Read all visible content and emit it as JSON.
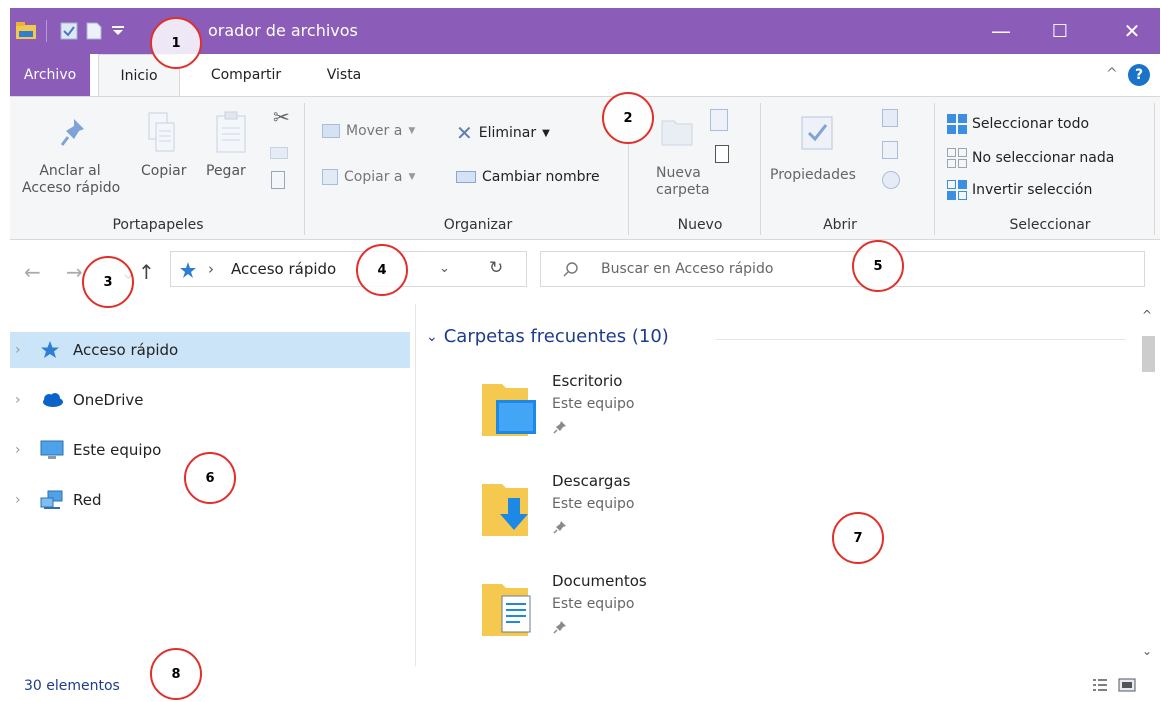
{
  "window": {
    "title": "orador de archivos",
    "controls": {
      "minimize": "—",
      "maximize": "☐",
      "close": "✕"
    }
  },
  "colors": {
    "accent": "#8b5cb8",
    "selection": "#cce4f7",
    "link": "#1e3c8c",
    "annotation": "#e0302a"
  },
  "tabs": [
    {
      "label": "Archivo"
    },
    {
      "label": "Inicio"
    },
    {
      "label": "Compartir"
    },
    {
      "label": "Vista"
    }
  ],
  "ribbon": {
    "portapapeles": {
      "label": "Portapapeles",
      "anclar_line1": "Anclar al",
      "anclar_line2": "Acceso rápido",
      "copiar": "Copiar",
      "pegar": "Pegar"
    },
    "organizar": {
      "label": "Organizar",
      "mover": "Mover a",
      "copiar_a": "Copiar a",
      "eliminar": "Eliminar",
      "cambiar": "Cambiar nombre"
    },
    "nuevo": {
      "label": "Nuevo",
      "nueva_line1": "Nueva",
      "nueva_line2": "carpeta"
    },
    "abrir": {
      "label": "Abrir",
      "propiedades": "Propiedades"
    },
    "seleccionar": {
      "label": "Seleccionar",
      "todo": "Seleccionar todo",
      "nada": "No seleccionar nada",
      "invertir": "Invertir selección"
    }
  },
  "navigation": {
    "address": "Acceso rápido",
    "search_placeholder": "Buscar en Acceso rápido"
  },
  "navpane": {
    "items": [
      {
        "label": "Acceso rápido",
        "icon": "quick-access-star-icon",
        "selected": true
      },
      {
        "label": "OneDrive",
        "icon": "onedrive-cloud-icon",
        "selected": false
      },
      {
        "label": "Este equipo",
        "icon": "computer-icon",
        "selected": false
      },
      {
        "label": "Red",
        "icon": "network-icon",
        "selected": false
      }
    ]
  },
  "content": {
    "section_title": "Carpetas frecuentes (10)",
    "folders": [
      {
        "name": "Escritorio",
        "location": "Este equipo",
        "icon": "desktop-folder-icon"
      },
      {
        "name": "Descargas",
        "location": "Este equipo",
        "icon": "downloads-folder-icon"
      },
      {
        "name": "Documentos",
        "location": "Este equipo",
        "icon": "documents-folder-icon"
      }
    ]
  },
  "status": {
    "text": "30 elementos"
  },
  "annotations": [
    "1",
    "2",
    "3",
    "4",
    "5",
    "6",
    "7",
    "8"
  ]
}
